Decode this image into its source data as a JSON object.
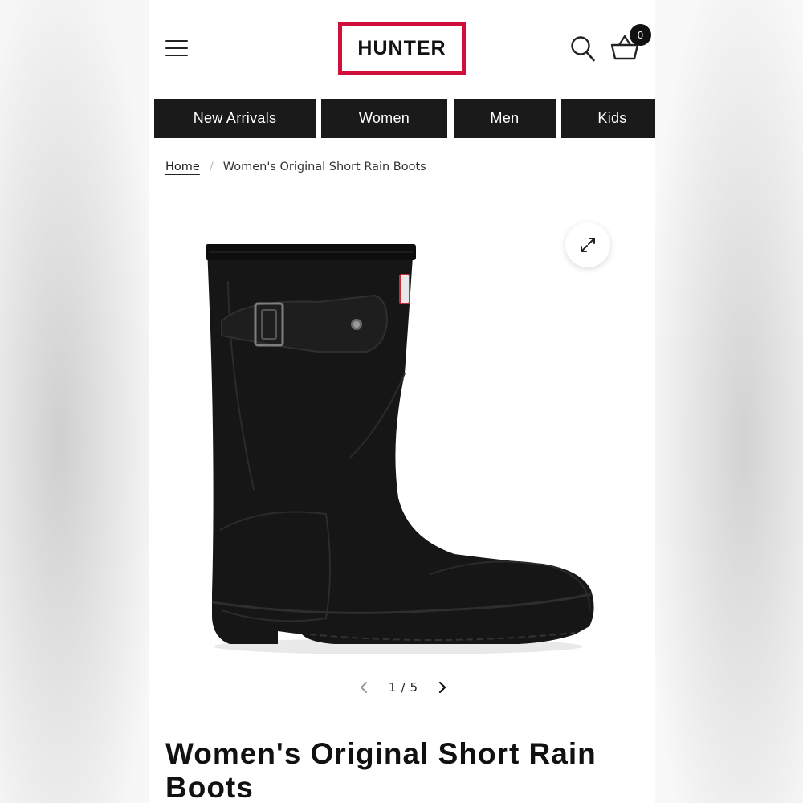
{
  "brand": {
    "logo_text": "HUNTER",
    "logo_color": "#d0103a"
  },
  "header": {
    "menu_icon": "hamburger-icon",
    "search_icon": "search-icon",
    "cart_icon": "basket-icon",
    "cart_count": "0"
  },
  "nav": {
    "items": [
      {
        "label": "New Arrivals"
      },
      {
        "label": "Women"
      },
      {
        "label": "Men"
      },
      {
        "label": "Kids"
      }
    ]
  },
  "breadcrumb": {
    "home": "Home",
    "separator": "/",
    "current": "Women's Original Short Rain Boots"
  },
  "gallery": {
    "expand_icon": "expand-icon",
    "current": "1",
    "separator": "/",
    "total": "5",
    "prev_icon": "chevron-left-icon",
    "next_icon": "chevron-right-icon"
  },
  "product": {
    "title": "Women's Original Short Rain Boots"
  }
}
